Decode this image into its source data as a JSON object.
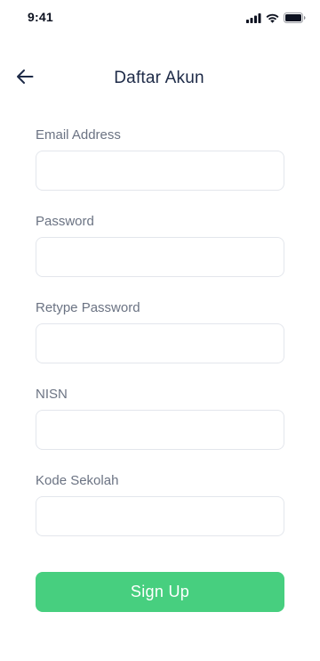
{
  "status_bar": {
    "time": "9:41",
    "icons": [
      "cellular-signal-icon",
      "wifi-icon",
      "battery-icon"
    ]
  },
  "header": {
    "back_icon": "arrow-left-icon",
    "title": "Daftar Akun"
  },
  "form": {
    "fields": [
      {
        "label": "Email Address",
        "value": "",
        "placeholder": ""
      },
      {
        "label": "Password",
        "value": "",
        "placeholder": ""
      },
      {
        "label": "Retype Password",
        "value": "",
        "placeholder": ""
      },
      {
        "label": "NISN",
        "value": "",
        "placeholder": ""
      },
      {
        "label": "Kode Sekolah",
        "value": "",
        "placeholder": ""
      }
    ],
    "submit_label": "Sign Up"
  },
  "colors": {
    "accent": "#47cf7f",
    "title_text": "#1d2a47",
    "label_text": "#6b7383",
    "input_border": "#e3e6ec",
    "background": "#ffffff"
  }
}
